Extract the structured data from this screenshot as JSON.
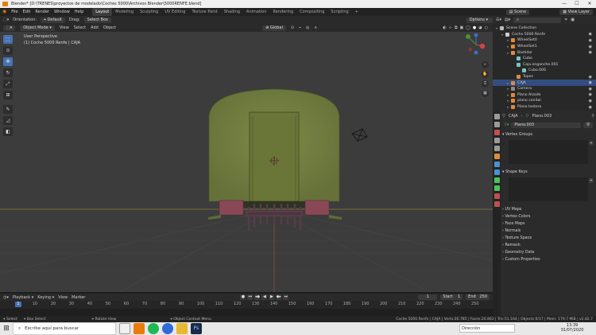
{
  "window": {
    "title": "Blender* [D:\\TRENES\\proyectos de modelado\\Coches 5000\\Archivos Blender\\5000RENFE.blend]",
    "controls": [
      "—",
      "☐",
      "✕"
    ]
  },
  "menubar": {
    "items": [
      "File",
      "Edit",
      "Render",
      "Window",
      "Help"
    ],
    "workspaces": [
      "Layout",
      "Modeling",
      "Sculpting",
      "UV Editing",
      "Texture Paint",
      "Shading",
      "Animation",
      "Rendering",
      "Compositing",
      "Scripting"
    ],
    "active_workspace": "Layout",
    "scene_label": "Scene",
    "view_layer_label": "View Layer"
  },
  "viewport_header": {
    "orientation_label": "Orientation:",
    "orientation_value": "Default",
    "drag_label": "Drag:",
    "drag_value": "Select Box",
    "mode": "Object Mode",
    "menus": [
      "View",
      "Select",
      "Add",
      "Object"
    ],
    "transform_orientation": "Global",
    "options_label": "Options"
  },
  "viewport": {
    "view_name": "User Perspective",
    "view_info": "(1) Coche 5000 Renfe | CAJA"
  },
  "timeline": {
    "menus": [
      "Playback",
      "Keying",
      "View",
      "Marker"
    ],
    "current_frame": "1",
    "start_label": "Start",
    "start": "1",
    "end_label": "End",
    "end": "250",
    "frame_field": "1",
    "ticks": [
      "1",
      "10",
      "20",
      "30",
      "40",
      "50",
      "60",
      "70",
      "80",
      "90",
      "100",
      "110",
      "120",
      "130",
      "140",
      "150",
      "160",
      "170",
      "180",
      "190",
      "200",
      "210",
      "220",
      "230",
      "240",
      "250"
    ]
  },
  "statusbar": {
    "select": "Select",
    "box_select": "Box Select",
    "rotate_view": "Rotate View",
    "context_menu": "Object Context Menu",
    "stats": "Coche 5000 Renfe | CAJA | Verts:26.785 | Faces:24.863 | Tris:51.164 | Objects:0/17 | Mem: 179.7 MiB | v2.82.7"
  },
  "taskbar": {
    "search_placeholder": "Escribe aquí para buscar",
    "direccion_label": "Dirección",
    "time": "13:39",
    "date": "31/07/2020"
  },
  "outliner": {
    "search_placeholder": "",
    "rows": [
      {
        "label": "Scene Collection",
        "indent": 0,
        "color": "#bbbbbb",
        "selected": false,
        "eye": false
      },
      {
        "label": "Coche 5000 Renfe",
        "indent": 1,
        "color": "#cccccc",
        "selected": false,
        "eye": true
      },
      {
        "label": "WheelSet0",
        "indent": 2,
        "color": "#e08a3a",
        "selected": false,
        "eye": true
      },
      {
        "label": "WheelSet1",
        "indent": 2,
        "color": "#e08a3a",
        "selected": false,
        "eye": true
      },
      {
        "label": "Bastidor",
        "indent": 2,
        "color": "#e08a3a",
        "selected": false,
        "eye": true
      },
      {
        "label": "Cubo",
        "indent": 3,
        "color": "#79c4c4",
        "selected": false,
        "eye": false
      },
      {
        "label": "Caja.enganche.001",
        "indent": 3,
        "color": "#79c4c4",
        "selected": false,
        "eye": false
      },
      {
        "label": "Cubo.006",
        "indent": 4,
        "color": "#79c4c4",
        "selected": false,
        "eye": false
      },
      {
        "label": "Topes",
        "indent": 3,
        "color": "#e08a3a",
        "selected": false,
        "eye": true
      },
      {
        "label": "CAJA",
        "indent": 2,
        "color": "#e08a3a",
        "selected": true,
        "eye": true
      },
      {
        "label": "Camera",
        "indent": 2,
        "color": "#8a8a8a",
        "selected": false,
        "eye": true
      },
      {
        "label": "Plano Alzado",
        "indent": 2,
        "color": "#e08a3a",
        "selected": false,
        "eye": true
      },
      {
        "label": "plano cenital",
        "indent": 2,
        "color": "#e08a3a",
        "selected": false,
        "eye": true
      },
      {
        "label": "Plano testero",
        "indent": 2,
        "color": "#e08a3a",
        "selected": false,
        "eye": true
      }
    ]
  },
  "properties": {
    "object_name": "CAJA",
    "mesh_name": "Plano.003",
    "data_field": "Plano.003",
    "panels": [
      "Vertex Groups",
      "Shape Keys",
      "UV Maps",
      "Vertex Colors",
      "Face Maps",
      "Normals",
      "Texture Space",
      "Remesh",
      "Geometry Data",
      "Custom Properties"
    ],
    "tab_colors": [
      "#9a9a9a",
      "#9a9a9a",
      "#c05050",
      "#9a9a9a",
      "#9a9a9a",
      "#e08a3a",
      "#4e8fd0",
      "#4e8fd0",
      "#4ec05a",
      "#4ec05a",
      "#c05050",
      "#c05050"
    ]
  },
  "colors": {
    "accent": "#4772b3",
    "train_body": "#6f7a3c",
    "train_door": "#677235",
    "buffer": "#8a4857"
  }
}
